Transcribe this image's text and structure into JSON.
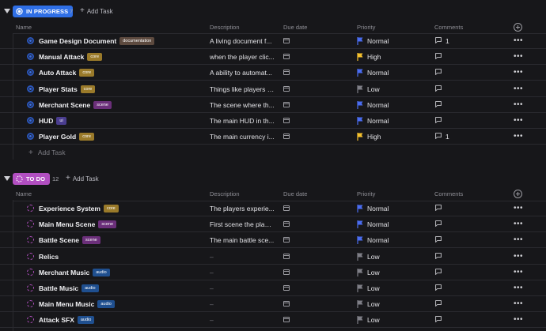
{
  "colors": {
    "in_progress": "#2f6fe6",
    "todo": "#b24fc1",
    "normal_flag": "#4a6cf0",
    "high_flag": "#f5c12e",
    "low_flag": "#7e7e86"
  },
  "columns": {
    "name": "Name",
    "description": "Description",
    "due_date": "Due date",
    "priority": "Priority",
    "comments": "Comments"
  },
  "groups": [
    {
      "status": "IN PROGRESS",
      "count": "7",
      "add_label": "Add Task",
      "add_row_label": "Add Task",
      "tasks": [
        {
          "name": "Game Design Document",
          "tag": "documentation",
          "tag_color": "#5d4a3f",
          "description": "A living document f...",
          "priority": "Normal",
          "flag": "normal",
          "comments": "1"
        },
        {
          "name": "Manual Attack",
          "tag": "core",
          "tag_color": "#9a7a2a",
          "description": "when the player clic...",
          "priority": "High",
          "flag": "high",
          "comments": ""
        },
        {
          "name": "Auto Attack",
          "tag": "core",
          "tag_color": "#9a7a2a",
          "description": "A ability to automat...",
          "priority": "Normal",
          "flag": "normal",
          "comments": ""
        },
        {
          "name": "Player Stats",
          "tag": "core",
          "tag_color": "#9a7a2a",
          "description": "Things like players a...",
          "priority": "Low",
          "flag": "low",
          "comments": ""
        },
        {
          "name": "Merchant Scene",
          "tag": "scene",
          "tag_color": "#6b2f7a",
          "description": "The scene where th...",
          "priority": "Normal",
          "flag": "normal",
          "comments": ""
        },
        {
          "name": "HUD",
          "tag": "ui",
          "tag_color": "#4a3d8f",
          "description": "The main HUD in th...",
          "priority": "Normal",
          "flag": "normal",
          "comments": ""
        },
        {
          "name": "Player Gold",
          "tag": "core",
          "tag_color": "#9a7a2a",
          "description": "The main currency i...",
          "priority": "High",
          "flag": "high",
          "comments": "1"
        }
      ]
    },
    {
      "status": "TO DO",
      "count": "12",
      "add_label": "Add Task",
      "tasks": [
        {
          "name": "Experience System",
          "tag": "core",
          "tag_color": "#9a7a2a",
          "description": "The players experie...",
          "priority": "Normal",
          "flag": "normal",
          "comments": ""
        },
        {
          "name": "Main Menu Scene",
          "tag": "scene",
          "tag_color": "#6b2f7a",
          "description": "First scene the playe...",
          "priority": "Normal",
          "flag": "normal",
          "comments": ""
        },
        {
          "name": "Battle Scene",
          "tag": "scene",
          "tag_color": "#6b2f7a",
          "description": "The main battle sce...",
          "priority": "Normal",
          "flag": "normal",
          "comments": ""
        },
        {
          "name": "Relics",
          "tag": "",
          "tag_color": "",
          "description": "–",
          "priority": "Low",
          "flag": "low",
          "comments": ""
        },
        {
          "name": "Merchant Music",
          "tag": "audio",
          "tag_color": "#1f4f8f",
          "description": "–",
          "priority": "Low",
          "flag": "low",
          "comments": ""
        },
        {
          "name": "Battle Music",
          "tag": "audio",
          "tag_color": "#1f4f8f",
          "description": "–",
          "priority": "Low",
          "flag": "low",
          "comments": ""
        },
        {
          "name": "Main Menu Music",
          "tag": "audio",
          "tag_color": "#1f4f8f",
          "description": "–",
          "priority": "Low",
          "flag": "low",
          "comments": ""
        },
        {
          "name": "Attack SFX",
          "tag": "audio",
          "tag_color": "#1f4f8f",
          "description": "–",
          "priority": "Low",
          "flag": "low",
          "comments": ""
        }
      ]
    }
  ]
}
